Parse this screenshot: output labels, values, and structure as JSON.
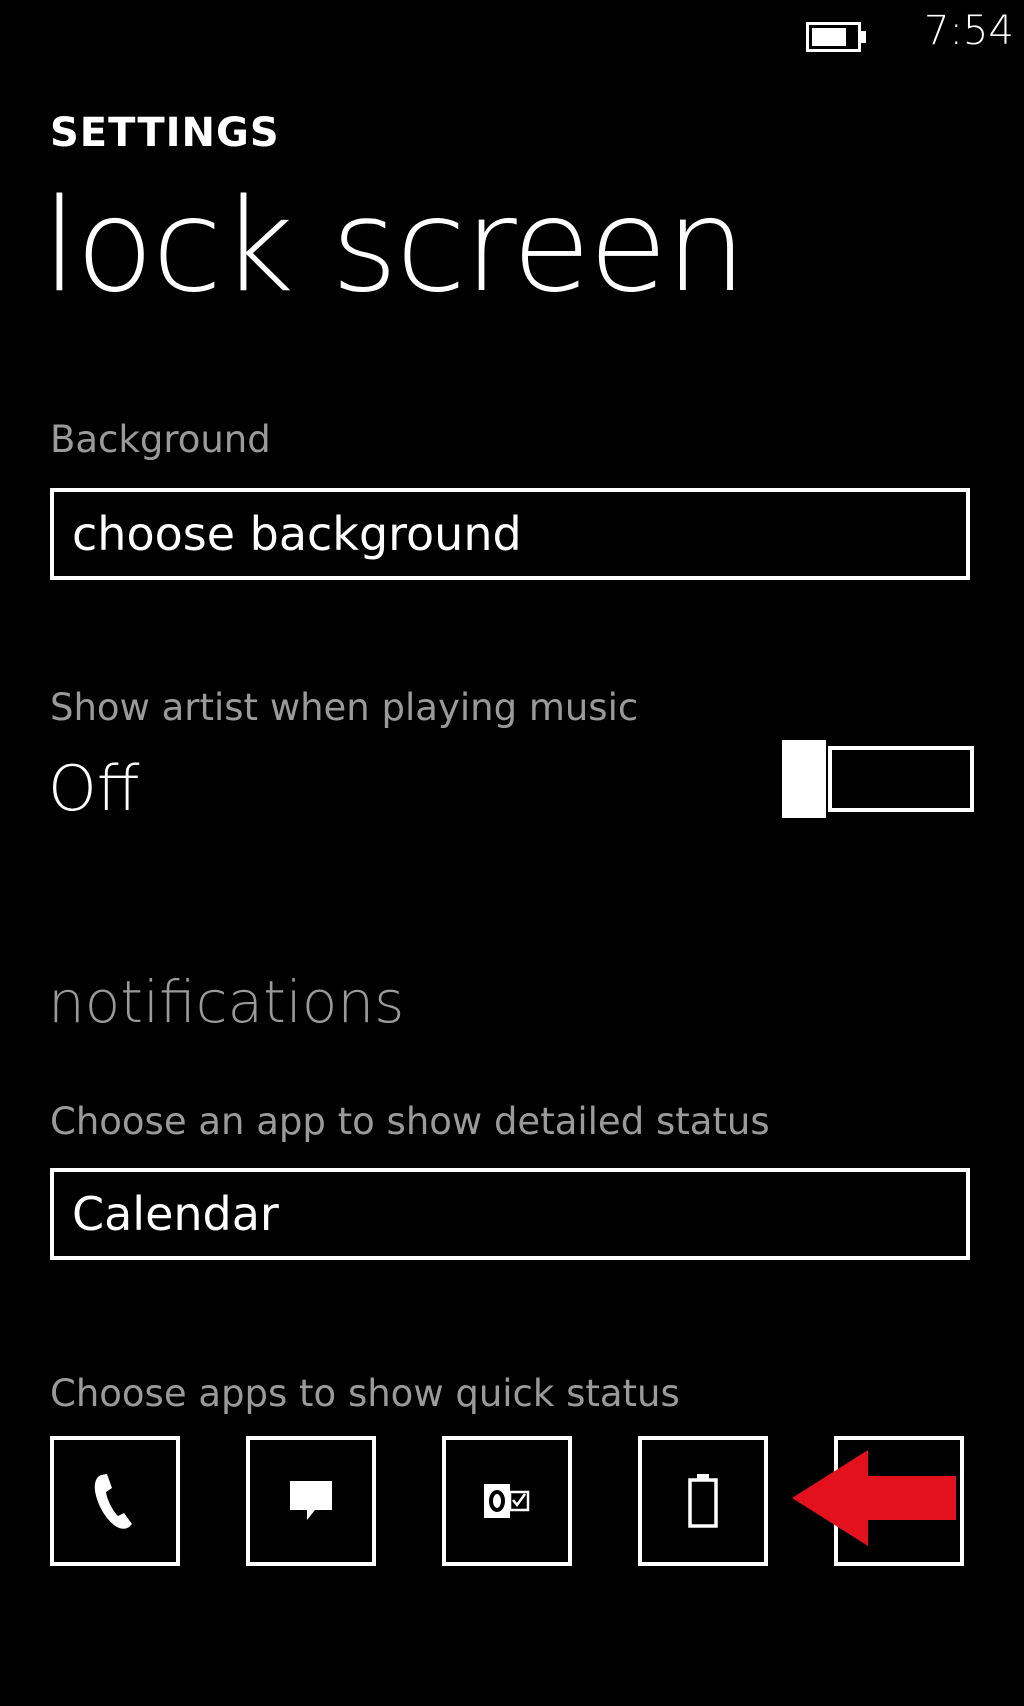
{
  "status_bar": {
    "time": "7:54",
    "battery_icon": "battery-icon"
  },
  "header": {
    "app_label": "SETTINGS",
    "page_title": "lock screen"
  },
  "background_section": {
    "label": "Background",
    "button_label": "choose background"
  },
  "music_setting": {
    "label": "Show artist when playing music",
    "value": "Off",
    "toggle_on": false
  },
  "notifications": {
    "heading": "notifications",
    "detailed_status_label": "Choose an app to show detailed status",
    "detailed_status_value": "Calendar",
    "quick_status_label": "Choose apps to show quick status",
    "quick_status_slots": [
      {
        "icon": "phone-icon"
      },
      {
        "icon": "messaging-icon"
      },
      {
        "icon": "outlook-icon"
      },
      {
        "icon": "battery-icon"
      },
      {
        "icon": "empty-slot"
      }
    ]
  },
  "annotation": {
    "arrow_icon": "red-arrow-icon",
    "arrow_color": "#e3101e"
  },
  "colors": {
    "background": "#000000",
    "foreground": "#ffffff",
    "subtle_text": "#9a9a9a"
  }
}
